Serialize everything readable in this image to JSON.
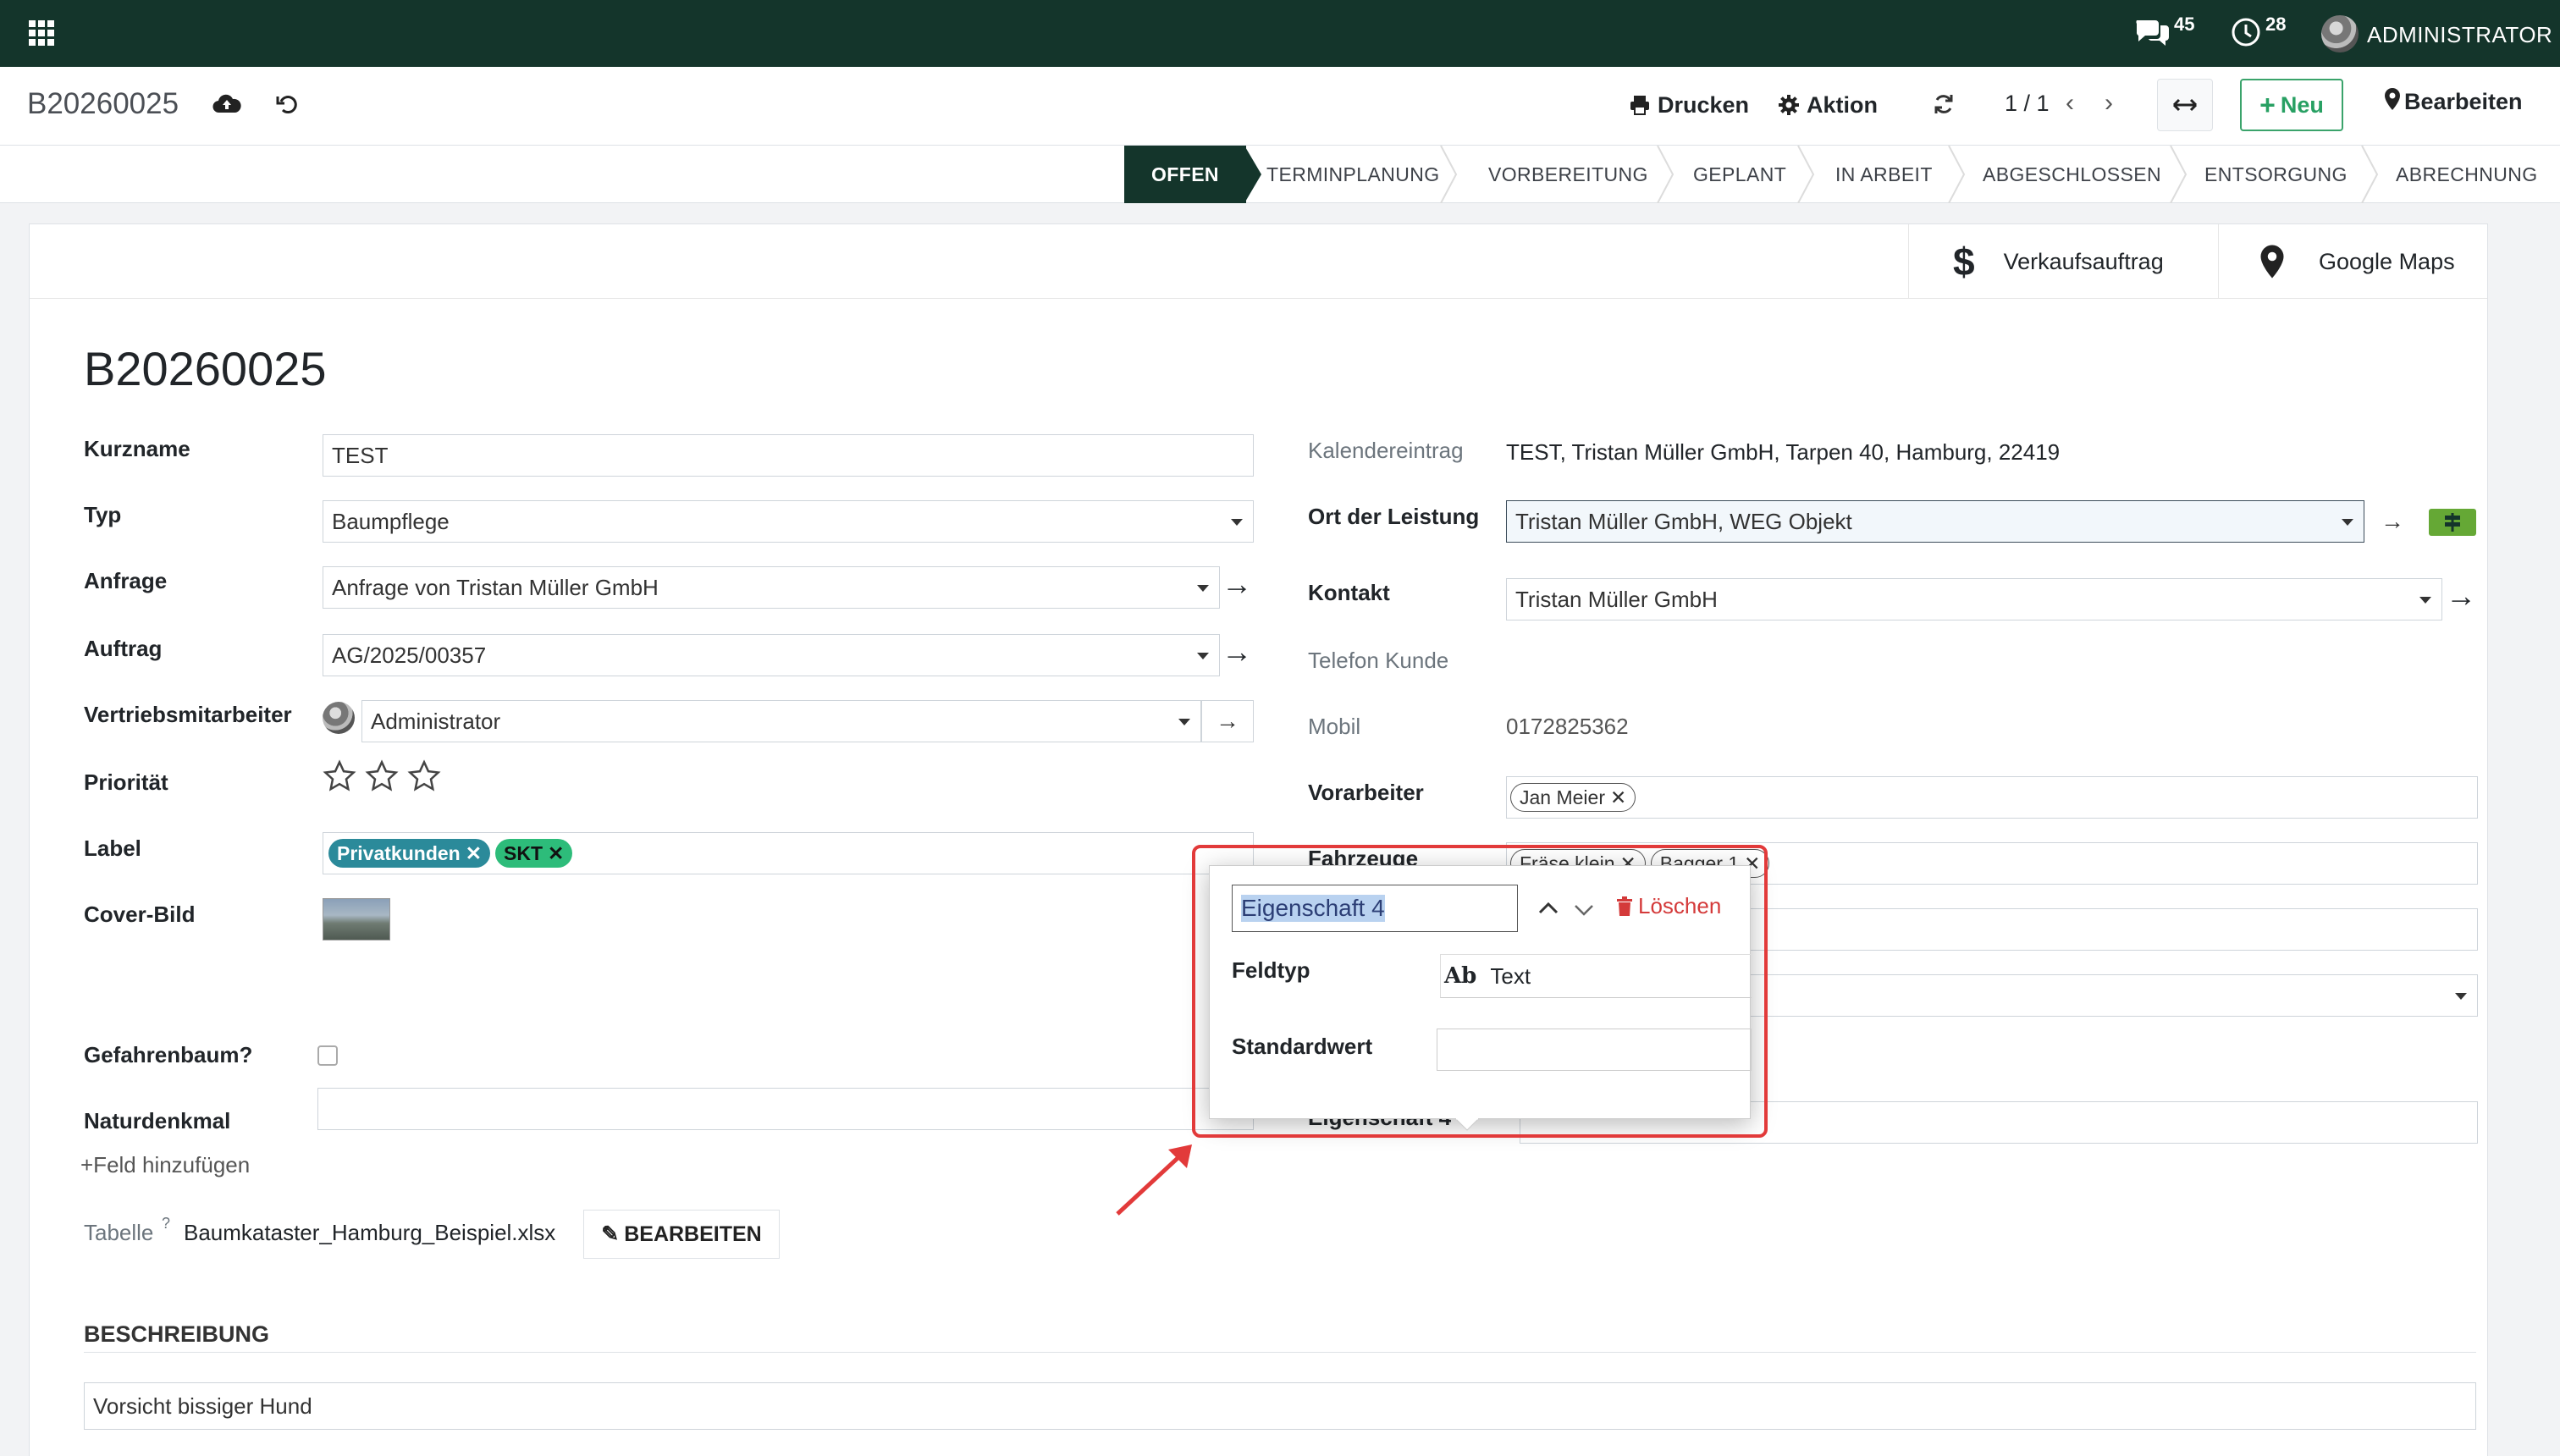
{
  "topbar": {
    "chat_count": "45",
    "activity_count": "28",
    "user_name": "ADMINISTRATOR"
  },
  "control_panel": {
    "breadcrumb": "B20260025",
    "print_label": "Drucken",
    "action_label": "Aktion",
    "pager": "1 / 1",
    "new_label": "Neu",
    "edit_label": "Bearbeiten"
  },
  "stages": [
    "OFFEN",
    "TERMINPLANUNG",
    "VORBEREITUNG",
    "GEPLANT",
    "IN ARBEIT",
    "ABGESCHLOSSEN",
    "ENTSORGUNG",
    "ABRECHNUNG"
  ],
  "smart_buttons": {
    "sales_order": "Verkaufsauftrag",
    "google_maps": "Google Maps"
  },
  "record": {
    "title": "B20260025"
  },
  "left_fields": {
    "kurzname_label": "Kurzname",
    "kurzname_value": "TEST",
    "typ_label": "Typ",
    "typ_value": "Baumpflege",
    "anfrage_label": "Anfrage",
    "anfrage_value": "Anfrage von Tristan Müller GmbH",
    "auftrag_label": "Auftrag",
    "auftrag_value": "AG/2025/00357",
    "vertrieb_label": "Vertriebsmitarbeiter",
    "vertrieb_value": "Administrator",
    "prioritaet_label": "Priorität",
    "label_label": "Label",
    "tags": [
      "Privatkunden",
      "SKT"
    ],
    "cover_label": "Cover-Bild",
    "gefahr_label": "Gefahrenbaum?",
    "natur_label": "Naturdenkmal",
    "add_field": "+Feld hinzufügen",
    "tabelle_label": "Tabelle",
    "tabelle_help": "?",
    "tabelle_file": "Baumkataster_Hamburg_Beispiel.xlsx",
    "tabelle_edit": "BEARBEITEN"
  },
  "right_fields": {
    "kalender_label": "Kalendereintrag",
    "kalender_value": "TEST, Tristan Müller GmbH, Tarpen 40, Hamburg, 22419",
    "ort_label": "Ort der Leistung",
    "ort_value": "Tristan Müller GmbH, WEG Objekt",
    "kontakt_label": "Kontakt",
    "kontakt_value": "Tristan Müller GmbH",
    "telefon_label": "Telefon Kunde",
    "mobil_label": "Mobil",
    "mobil_value": "0172825362",
    "vorarbeiter_label": "Vorarbeiter",
    "vorarbeiter_tag": "Jan Meier",
    "fahrzeuge_label": "Fahrzeuge",
    "fahrzeuge_tags": [
      "Fräse klein",
      "Bagger 1"
    ],
    "eigenschaft_label": "Eigenschaft 4"
  },
  "popover": {
    "name_value": "Eigenschaft 4",
    "delete_label": "Löschen",
    "feldtyp_label": "Feldtyp",
    "feldtyp_icon": "Ab",
    "feldtyp_value": "Text",
    "standard_label": "Standardwert"
  },
  "description": {
    "heading": "BESCHREIBUNG",
    "value": "Vorsicht bissiger Hund"
  },
  "colors": {
    "topbar": "#14352b",
    "accent_green": "#28a063",
    "highlight_red": "#e23a3a",
    "delete_red": "#d43a3a",
    "tag_blue": "#2b8a9a",
    "tag_green": "#2dbc7a"
  }
}
